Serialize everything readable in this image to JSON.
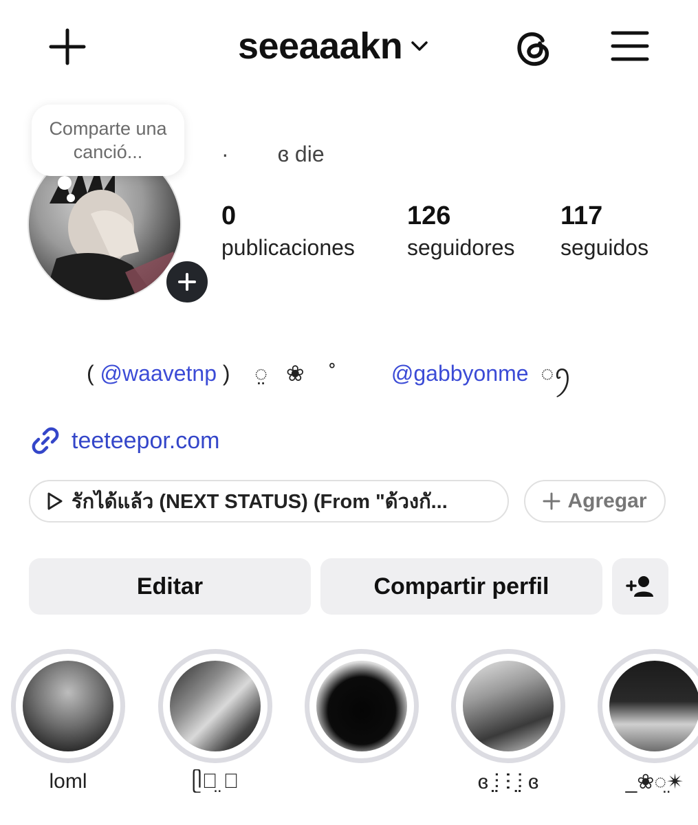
{
  "header": {
    "username": "seeaaakn",
    "icons": {
      "create": "plus-icon",
      "switch_account": "chevron-down-icon",
      "threads": "threads-icon",
      "menu": "hamburger-menu-icon"
    }
  },
  "profile": {
    "note_bubble": "Comparte una canció...",
    "display_name": "·        ɞ die",
    "stats": [
      {
        "number": "0",
        "label": "publicaciones"
      },
      {
        "number": "126",
        "label": "seguidores"
      },
      {
        "number": "117",
        "label": "seguidos"
      }
    ],
    "bio": {
      "open_paren": "( ",
      "mention1": "@waavetnp",
      "middle": " )    ◌̤   ❀    ˚         ",
      "mention2": "@gabbyonme",
      "end": "  ◌ꪆ"
    },
    "link": "teeteepor.com",
    "music": "รักได้แล้ว (NEXT STATUS) (From \"ด้วงกั...",
    "add_label": "Agregar"
  },
  "actions": {
    "edit": "Editar",
    "share": "Compartir perfil"
  },
  "highlights": [
    {
      "label": "loml"
    },
    {
      "label": "ᥫ᭡̤ ⍰"
    },
    {
      "label": ""
    },
    {
      "label": "ɞ ⫶̤ ⵗ ⫶̤ ɞ"
    },
    {
      "label": "_❀◌̤✴"
    }
  ]
}
